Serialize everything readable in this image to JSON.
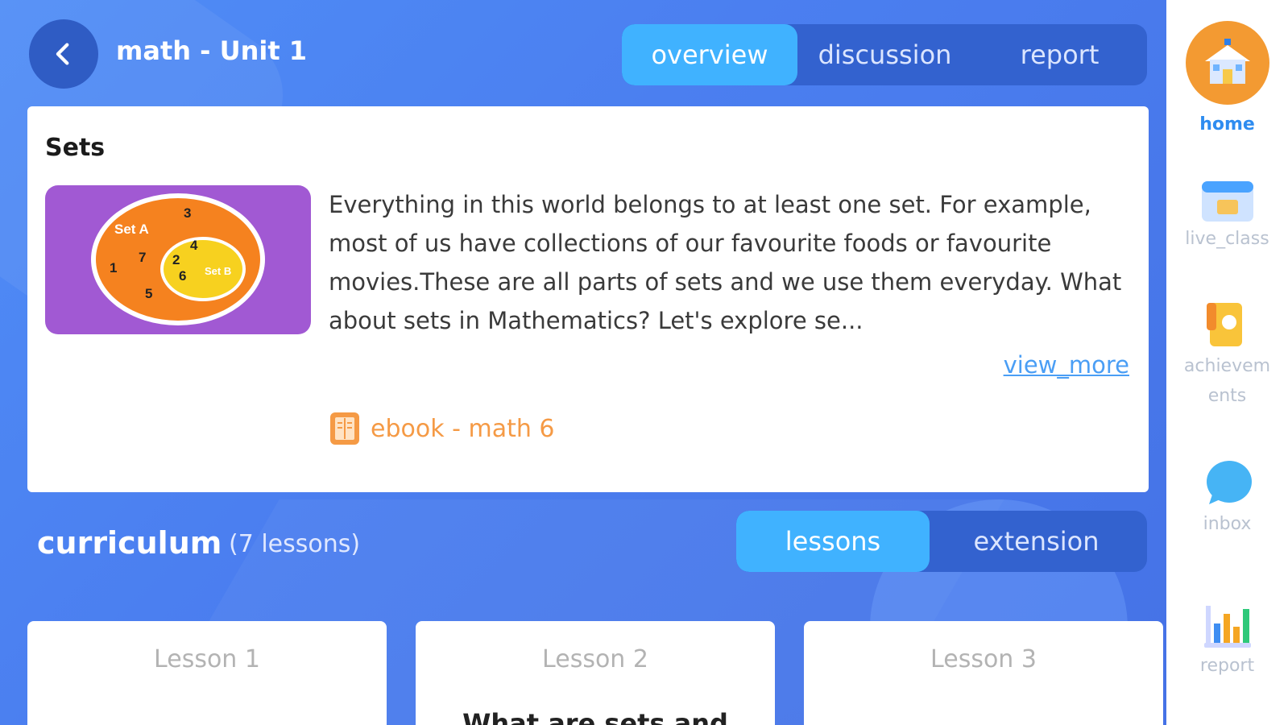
{
  "header": {
    "back_icon": "chevron-left-icon",
    "title": "math - Unit 1",
    "tabs": [
      {
        "label": "overview",
        "active": true
      },
      {
        "label": "discussion",
        "active": false
      },
      {
        "label": "report",
        "active": false
      }
    ]
  },
  "overview": {
    "title": "Sets",
    "thumbnail": {
      "set_a_label": "Set A",
      "set_b_label": "Set B",
      "set_a_numbers": [
        "3",
        "7",
        "1",
        "5"
      ],
      "set_b_numbers": [
        "4",
        "2",
        "6"
      ]
    },
    "description": "Everything in this world belongs to at least one set. For example, most of us have collections of our favourite foods or favourite movies.These are all parts of sets and we use them everyday.  What about sets in Mathematics? Let's explore se...",
    "view_more": "view_more",
    "ebook_label": "ebook - math 6",
    "ebook_icon": "book-icon"
  },
  "curriculum": {
    "title": "curriculum",
    "count": "(7 lessons)",
    "tabs": [
      {
        "label": "lessons",
        "active": true
      },
      {
        "label": "extension",
        "active": false
      }
    ],
    "lessons": [
      {
        "label": "Lesson 1",
        "heading": ""
      },
      {
        "label": "Lesson 2",
        "heading": "What are sets and"
      },
      {
        "label": "Lesson 3",
        "heading": ""
      }
    ]
  },
  "sidebar": {
    "items": [
      {
        "label": "home",
        "icon": "school-house-icon",
        "active": true
      },
      {
        "label": "live_class",
        "icon": "live-class-icon",
        "active": false
      },
      {
        "label": "achievements",
        "icon": "achievement-badge-icon",
        "active": false
      },
      {
        "label": "inbox",
        "icon": "chat-bubble-icon",
        "active": false
      },
      {
        "label": "report",
        "icon": "bar-chart-icon",
        "active": false
      }
    ]
  },
  "colors": {
    "background": "#4b7ff0",
    "active_tab": "#40b2ff",
    "tab_group": "#3362cf",
    "accent_orange": "#f59a45",
    "link_blue": "#4a9ef5"
  }
}
